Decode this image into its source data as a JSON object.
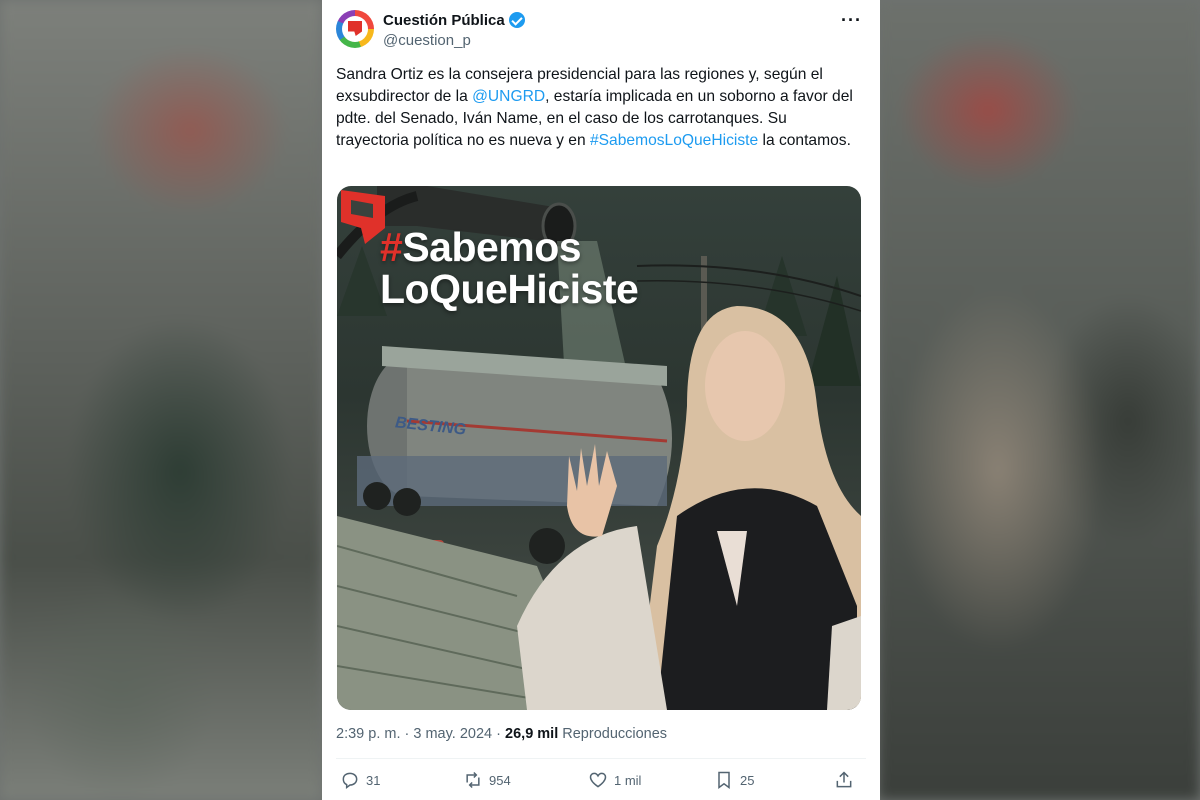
{
  "account": {
    "display_name": "Cuestión Pública",
    "handle": "@cuestion_p",
    "verified": true
  },
  "tweet": {
    "text_parts": {
      "p1": "Sandra Ortiz es la consejera presidencial para las regiones y, según el exsubdirector de la ",
      "mention": "@UNGRD",
      "p2": ", estaría implicada en un soborno a favor del pdte. del Senado, Iván Name, en el caso de los carrotanques. Su trayectoria política no es nueva y en ",
      "hashtag": "#SabemosLoQueHiciste",
      "p3": " la contamos."
    },
    "image": {
      "title_hash": "#",
      "title_line1": "Sabemos",
      "title_line2": "LoQueHiciste",
      "tanker_text": "BESTING"
    },
    "time": "2:39 p. m.",
    "sep": "·",
    "date": "3 may. 2024",
    "views_count": "26,9 mil",
    "views_label": "Reproducciones"
  },
  "actions": {
    "replies": "31",
    "reposts": "954",
    "likes": "1 mil",
    "bookmarks": "25"
  },
  "colors": {
    "link": "#1d9bf0",
    "brand_red": "#e0312a",
    "text": "#0f1419",
    "muted": "#536471"
  }
}
